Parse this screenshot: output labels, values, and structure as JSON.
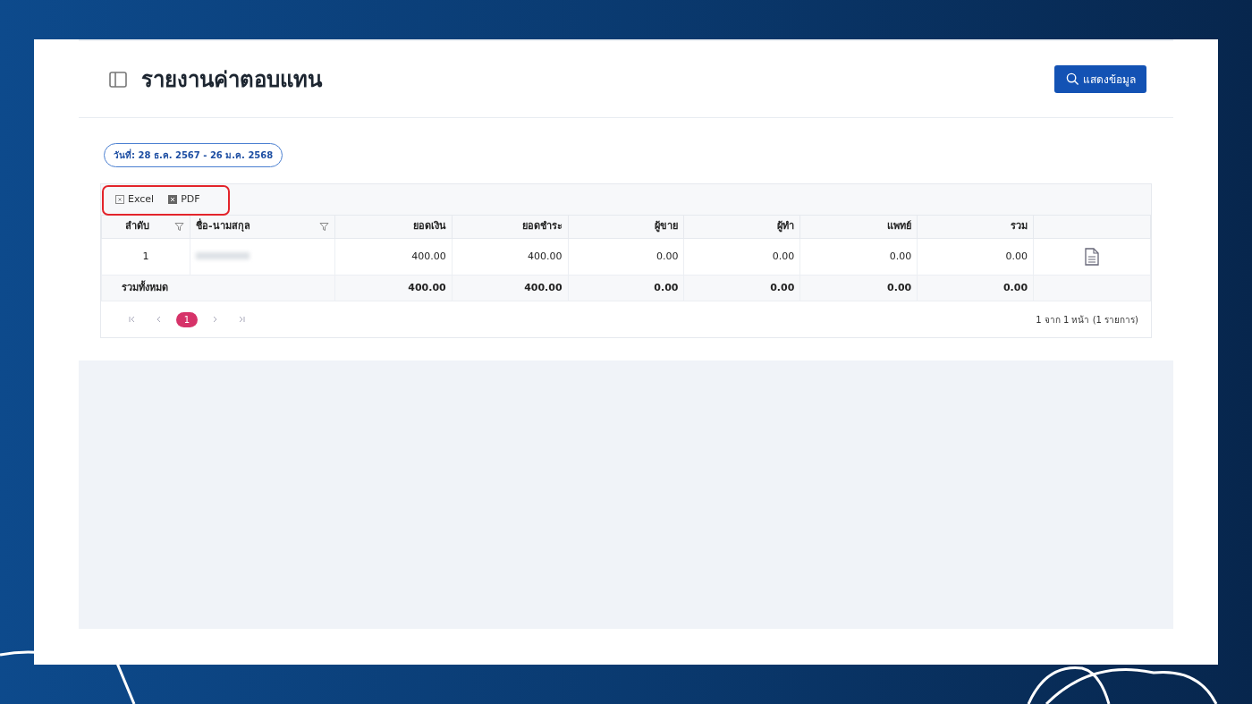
{
  "page": {
    "title": "รายงานค่าตอบแทน",
    "search_button": "แสดงข้อมูล",
    "date_range": "วันที่: 28 ธ.ค. 2567 - 26 ม.ค. 2568"
  },
  "export_buttons": [
    {
      "kind": "excel",
      "label": "Excel"
    },
    {
      "kind": "pdf",
      "label": "PDF"
    }
  ],
  "table": {
    "columns": [
      {
        "kind": "index",
        "label": "ลำดับ",
        "filter": true
      },
      {
        "kind": "name",
        "label": "ชื่อ-นามสกุล",
        "filter": true
      },
      {
        "kind": "amount",
        "label": "ยอดเงิน",
        "filter": false
      },
      {
        "kind": "amount",
        "label": "ยอดชำระ",
        "filter": false
      },
      {
        "kind": "amount",
        "label": "ผู้ขาย",
        "filter": false
      },
      {
        "kind": "amount",
        "label": "ผู้ทำ",
        "filter": false
      },
      {
        "kind": "amount",
        "label": "แพทย์",
        "filter": false
      },
      {
        "kind": "amount",
        "label": "รวม",
        "filter": false
      }
    ],
    "rows": [
      {
        "cells": [
          {
            "kind": "text",
            "text": "1"
          },
          {
            "kind": "redacted"
          },
          {
            "kind": "text",
            "text": "400.00"
          },
          {
            "kind": "text",
            "text": "400.00"
          },
          {
            "kind": "text",
            "text": "0.00"
          },
          {
            "kind": "text",
            "text": "0.00"
          },
          {
            "kind": "text",
            "text": "0.00"
          },
          {
            "kind": "text",
            "text": "0.00"
          },
          {
            "kind": "document"
          }
        ]
      }
    ],
    "footer": {
      "label": "รวมทั้งหมด",
      "totals": [
        "400.00",
        "400.00",
        "0.00",
        "0.00",
        "0.00",
        "0.00"
      ]
    }
  },
  "pagination": {
    "pages": [
      {
        "label": "1",
        "selected": true
      }
    ],
    "summary": "1 จาก 1 หน้า (1 รายการ)"
  }
}
